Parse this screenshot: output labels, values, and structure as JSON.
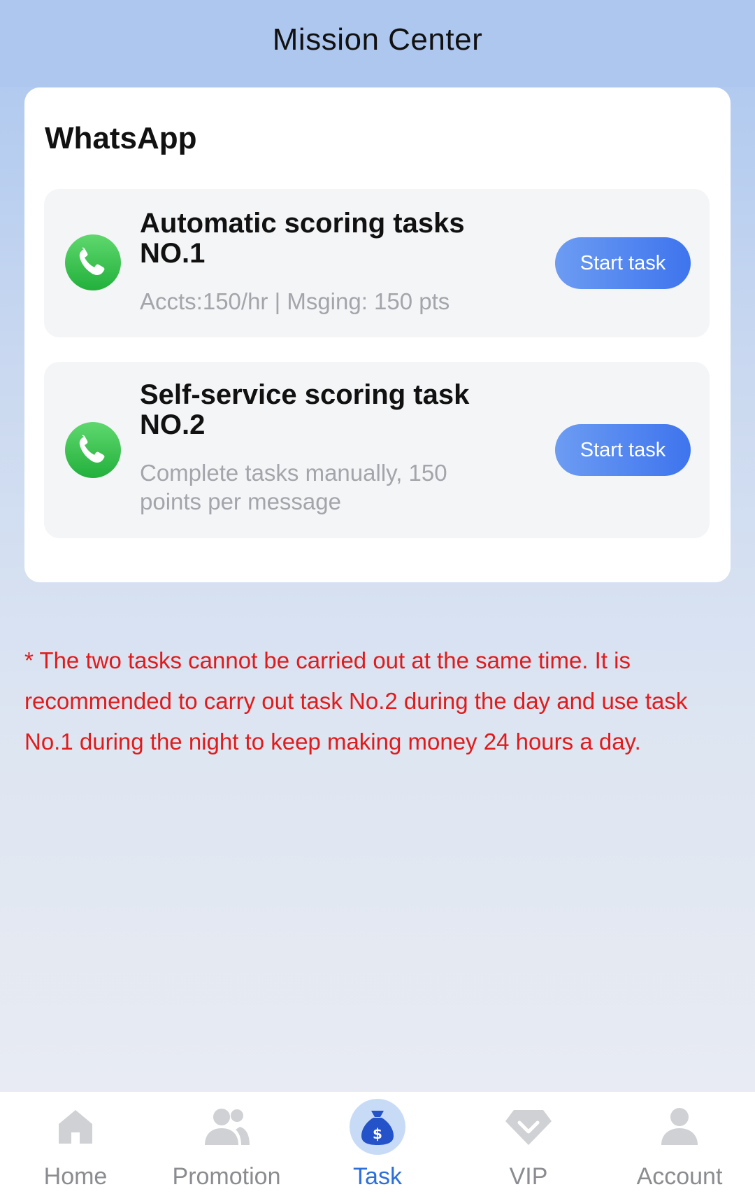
{
  "header": {
    "title": "Mission Center"
  },
  "section": {
    "title": "WhatsApp"
  },
  "tasks": [
    {
      "icon": "whatsapp-phone-icon",
      "name": "Automatic scoring tasks NO.1",
      "description": "Accts:150/hr | Msging: 150 pts",
      "button": "Start task"
    },
    {
      "icon": "whatsapp-phone-icon",
      "name": "Self-service scoring task NO.2",
      "description": "Complete tasks manually, 150 points per message",
      "button": "Start task"
    }
  ],
  "notice": "* The two tasks cannot be carried out at the same time. It is recommended to carry out task No.2 during the day and use task No.1 during the night to keep making money 24 hours a day.",
  "tabbar": {
    "items": [
      {
        "label": "Home",
        "icon": "home-icon",
        "active": false
      },
      {
        "label": "Promotion",
        "icon": "users-icon",
        "active": false
      },
      {
        "label": "Task",
        "icon": "money-bag-icon",
        "active": true
      },
      {
        "label": "VIP",
        "icon": "diamond-icon",
        "active": false
      },
      {
        "label": "Account",
        "icon": "person-icon",
        "active": false
      }
    ]
  },
  "colors": {
    "header_bg": "#aec7ef",
    "button_start": "#6c9cf2",
    "button_end": "#3e74ee",
    "notice_text": "#e01b1b",
    "whatsapp_green": "#2fbf4a",
    "active_tab": "#2d6fd9",
    "inactive_tab": "#8a8c90"
  }
}
